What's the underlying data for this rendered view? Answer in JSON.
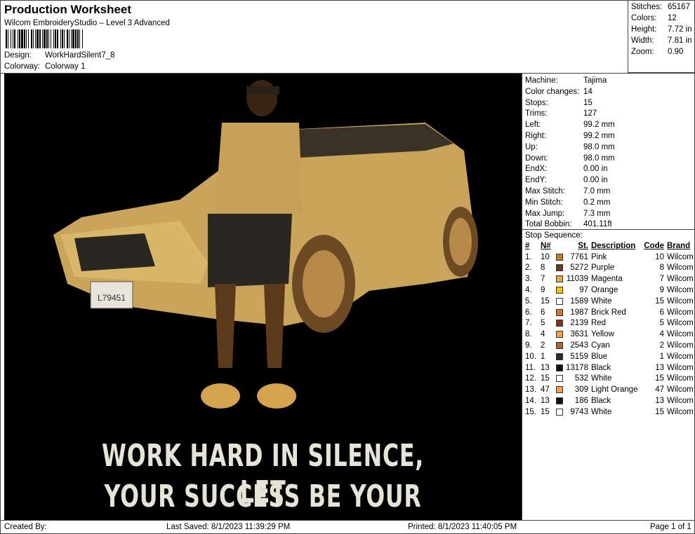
{
  "header": {
    "title": "Production Worksheet",
    "subtitle": "Wilcom EmbroideryStudio – Level 3 Advanced",
    "design_label": "Design:",
    "design_value": "WorkHardSilent7_8",
    "colorway_label": "Colorway:",
    "colorway_value": "Colorway 1"
  },
  "stats": [
    {
      "k": "Stitches:",
      "v": "65167"
    },
    {
      "k": "Colors:",
      "v": "12"
    },
    {
      "k": "Height:",
      "v": "7.72 in"
    },
    {
      "k": "Width:",
      "v": "7.81 in"
    },
    {
      "k": "Zoom:",
      "v": "0.90"
    }
  ],
  "design": {
    "line1": "WORK HARD IN SILENCE, LET",
    "line2": "YOUR SUCCESS BE YOUR NOISE",
    "plate": "L79451"
  },
  "machine_info": [
    {
      "k": "Machine:",
      "v": "Tajima"
    },
    {
      "k": "Color changes:",
      "v": "14"
    },
    {
      "k": "Stops:",
      "v": "15"
    },
    {
      "k": "Trims:",
      "v": "127"
    },
    {
      "k": "Left:",
      "v": "99.2 mm"
    },
    {
      "k": "Right:",
      "v": "99.2 mm"
    },
    {
      "k": "Up:",
      "v": "98.0 mm"
    },
    {
      "k": "Down:",
      "v": "98.0 mm"
    },
    {
      "k": "EndX:",
      "v": "0.00 in"
    },
    {
      "k": "EndY:",
      "v": "0.00 in"
    },
    {
      "k": "Max Stitch:",
      "v": "7.0 mm"
    },
    {
      "k": "Min Stitch:",
      "v": "0.2 mm"
    },
    {
      "k": "Max Jump:",
      "v": "7.3 mm"
    },
    {
      "k": "Total Bobbin:",
      "v": "401.11ft"
    }
  ],
  "stop_sequence": {
    "title": "Stop Sequence:",
    "headers": [
      "#",
      "N#",
      "St.",
      "Description",
      "Code",
      "Brand"
    ],
    "rows": [
      {
        "i": "1.",
        "n": "10",
        "color": "#c97a2c",
        "st": "7761",
        "desc": "Pink",
        "code": "10",
        "brand": "Wilcom"
      },
      {
        "i": "2.",
        "n": "8",
        "color": "#6b3a1e",
        "st": "5272",
        "desc": "Purple",
        "code": "8",
        "brand": "Wilcom"
      },
      {
        "i": "3.",
        "n": "7",
        "color": "#e8a94a",
        "st": "11039",
        "desc": "Magenta",
        "code": "7",
        "brand": "Wilcom"
      },
      {
        "i": "4.",
        "n": "9",
        "color": "#f2c400",
        "st": "97",
        "desc": "Orange",
        "code": "9",
        "brand": "Wilcom"
      },
      {
        "i": "5.",
        "n": "15",
        "color": "#ffffff",
        "st": "1589",
        "desc": "White",
        "code": "15",
        "brand": "Wilcom"
      },
      {
        "i": "6.",
        "n": "6",
        "color": "#d9782a",
        "st": "1987",
        "desc": "Brick Red",
        "code": "6",
        "brand": "Wilcom"
      },
      {
        "i": "7.",
        "n": "5",
        "color": "#7a3a0c",
        "st": "2139",
        "desc": "Red",
        "code": "5",
        "brand": "Wilcom"
      },
      {
        "i": "8.",
        "n": "4",
        "color": "#f0a04a",
        "st": "3631",
        "desc": "Yellow",
        "code": "4",
        "brand": "Wilcom"
      },
      {
        "i": "9.",
        "n": "2",
        "color": "#a8683a",
        "st": "2543",
        "desc": "Cyan",
        "code": "2",
        "brand": "Wilcom"
      },
      {
        "i": "10.",
        "n": "1",
        "color": "#2a2a2a",
        "st": "5159",
        "desc": "Blue",
        "code": "1",
        "brand": "Wilcom"
      },
      {
        "i": "11.",
        "n": "13",
        "color": "#111111",
        "st": "13178",
        "desc": "Black",
        "code": "13",
        "brand": "Wilcom"
      },
      {
        "i": "12.",
        "n": "15",
        "color": "#ffffff",
        "st": "532",
        "desc": "White",
        "code": "15",
        "brand": "Wilcom"
      },
      {
        "i": "13.",
        "n": "47",
        "color": "#f0a050",
        "st": "309",
        "desc": "Light Orange",
        "code": "47",
        "brand": "Wilcom"
      },
      {
        "i": "14.",
        "n": "13",
        "color": "#111111",
        "st": "186",
        "desc": "Black",
        "code": "13",
        "brand": "Wilcom"
      },
      {
        "i": "15.",
        "n": "15",
        "color": "#ffffff",
        "st": "9743",
        "desc": "White",
        "code": "15",
        "brand": "Wilcom"
      }
    ]
  },
  "footer": {
    "created": "Created By:",
    "saved": "Last Saved: 8/1/2023 11:39:29 PM",
    "printed": "Printed: 8/1/2023 11:40:05 PM",
    "page": "Page 1 of 1"
  }
}
